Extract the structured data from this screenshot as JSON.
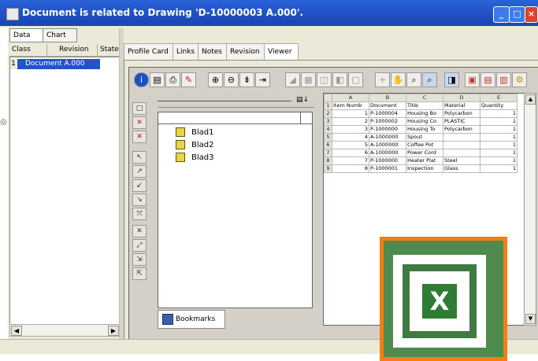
{
  "window": {
    "title": "Document is related to Drawing  'D-10000003 A.000'."
  },
  "left_tabs": [
    "Data",
    "Chart"
  ],
  "left_grid": {
    "columns": [
      "Class",
      "Revision",
      "State"
    ],
    "selected_row_num": "1",
    "selected_row_text": "Document A.000"
  },
  "right_tabs": [
    "Profile Card",
    "Links",
    "Notes",
    "Revision",
    "Viewer"
  ],
  "active_tab": "Viewer",
  "bookmarks": {
    "nodes": [
      "Blad1",
      "Blad2",
      "Blad3"
    ],
    "tab_label": "Bookmarks"
  },
  "spreadsheet": {
    "col_letters": [
      "A",
      "B",
      "C",
      "D",
      "E"
    ],
    "header_row": [
      "Item Numb",
      "Document",
      "Title",
      "Material",
      "Quantity"
    ],
    "rows": [
      [
        "1",
        "P-1000004",
        "Housing Bo",
        "Polycarbon",
        "1"
      ],
      [
        "2",
        "P-1000002",
        "Housing Co",
        "PLASTIC",
        "1"
      ],
      [
        "3",
        "P-1000000",
        "Housing To",
        "Polycarbon",
        "1"
      ],
      [
        "4",
        "A-1000000",
        "Spout",
        "",
        "1"
      ],
      [
        "5",
        "A-1000000",
        "Coffee Pot",
        "",
        "1"
      ],
      [
        "6",
        "A-1000000",
        "Power Cord",
        "",
        "1"
      ],
      [
        "7",
        "P-1000000",
        "Heater Plat",
        "Steel",
        "1"
      ],
      [
        "8",
        "P-1000001",
        "Inspection",
        "Glass",
        "1"
      ]
    ],
    "row_numbers": [
      "1",
      "2",
      "3",
      "4",
      "5",
      "6",
      "7",
      "8",
      "9"
    ]
  },
  "toolbar_icons": [
    "info-icon",
    "print-preview-icon",
    "print-icon",
    "markup-icon",
    "zoom-in-icon",
    "zoom-out-icon",
    "fit-width-icon",
    "fit-page-icon",
    "pan-icon",
    "zoom-window-icon",
    "zoom-fit-icon",
    "layer-icon"
  ],
  "colors": {
    "titlebar": "#1f4fc2",
    "selection": "#2155c7",
    "excel_frame": "#f27f0f",
    "excel_green": "#2f7c34"
  }
}
